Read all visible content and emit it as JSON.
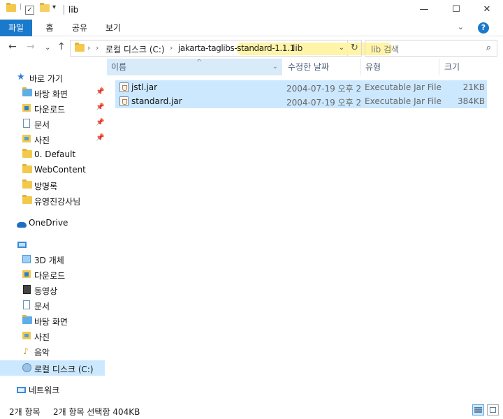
{
  "window": {
    "title": "lib",
    "minimize_icon": "minimize-icon",
    "maximize_icon": "maximize-icon",
    "close_icon": "close-icon"
  },
  "ribbon": {
    "tabs": [
      {
        "label": "파일"
      },
      {
        "label": "홈"
      },
      {
        "label": "공유"
      },
      {
        "label": "보기"
      }
    ],
    "accent": "#1979ca"
  },
  "address": {
    "segments": [
      "로컬 디스크 (C:)",
      "jakarta-taglibs-standard-1.1.1",
      "lib"
    ],
    "highlight_color": "#fff3a3"
  },
  "search": {
    "placeholder": "lib 검색"
  },
  "sidebar": {
    "quick_access": "바로 가기",
    "pinned": [
      {
        "label": "바탕 화면",
        "pinned": true
      },
      {
        "label": "다운로드",
        "pinned": true
      },
      {
        "label": "문서",
        "pinned": true
      },
      {
        "label": "사진",
        "pinned": true
      },
      {
        "label": "0. Default",
        "pinned": false
      },
      {
        "label": "WebContent",
        "pinned": false
      },
      {
        "label": "방명록",
        "pinned": false
      },
      {
        "label": "유영진강사님",
        "pinned": false
      }
    ],
    "onedrive": "OneDrive",
    "this_pc_items": [
      {
        "label": "3D 개체"
      },
      {
        "label": "다운로드"
      },
      {
        "label": "동영상"
      },
      {
        "label": "문서"
      },
      {
        "label": "바탕 화면"
      },
      {
        "label": "사진"
      },
      {
        "label": "음악"
      },
      {
        "label": "로컬 디스크 (C:)"
      }
    ],
    "network": "네트워크",
    "selected_color": "#cce8ff"
  },
  "columns": {
    "name": "이름",
    "modified": "수정한 날짜",
    "type": "유형",
    "size": "크기"
  },
  "files": [
    {
      "name": "jstl.jar",
      "modified": "2004-07-19 오후 2",
      "type": "Executable Jar File",
      "size": "21KB"
    },
    {
      "name": "standard.jar",
      "modified": "2004-07-19 오후 2",
      "type": "Executable Jar File",
      "size": "384KB"
    }
  ],
  "status": {
    "count": "2개 항목",
    "selection": "2개 항목 선택함 404KB"
  }
}
